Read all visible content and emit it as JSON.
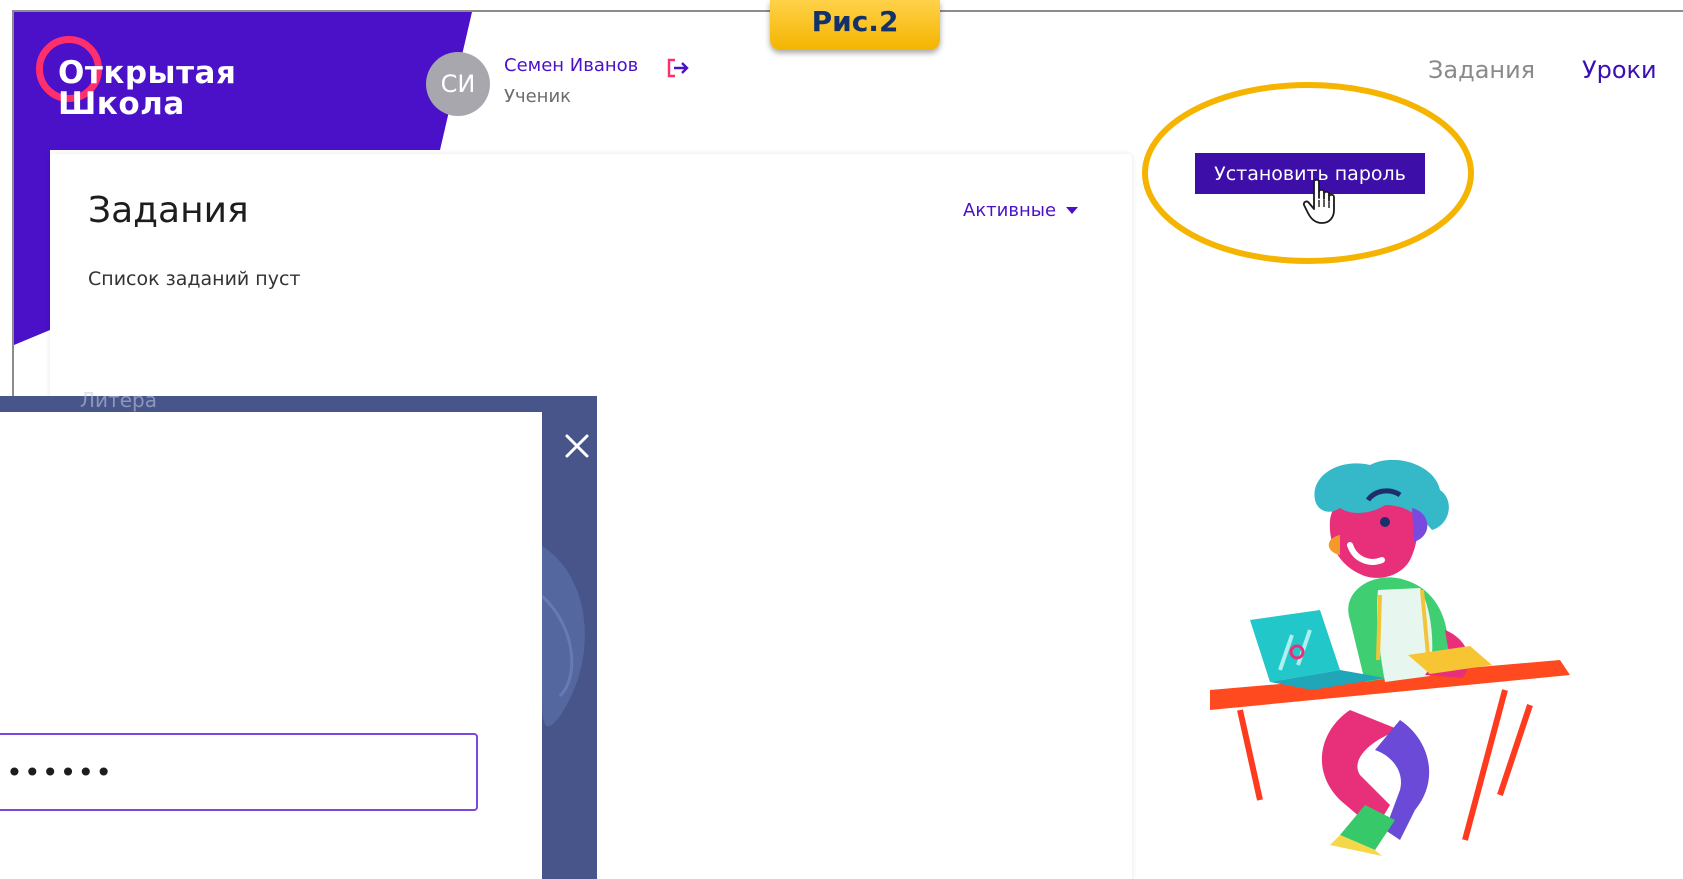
{
  "figure_tag": "Рис.2",
  "brand": {
    "logo_line1": "Открытая",
    "logo_line2": "Школа",
    "colors": {
      "purple": "#4a11c9",
      "ring": "#ff2e6c"
    }
  },
  "user": {
    "initials": "СИ",
    "name": "Семен Иванов",
    "role": "Ученик",
    "logout_icon": "logout-icon"
  },
  "nav": {
    "tasks": "Задания",
    "lessons": "Уроки"
  },
  "tasks_card": {
    "title": "Задания",
    "filter_label": "Активные",
    "empty_message": "Список заданий пуст"
  },
  "actions": {
    "set_password": "Установить пароль"
  },
  "modal": {
    "ghost_text": "Литера",
    "password_value": "••••••",
    "close_icon": "close-icon"
  },
  "accent_colors": {
    "highlight": "#f4b400",
    "button": "#3d0ea8",
    "overlay": "#48558a"
  }
}
